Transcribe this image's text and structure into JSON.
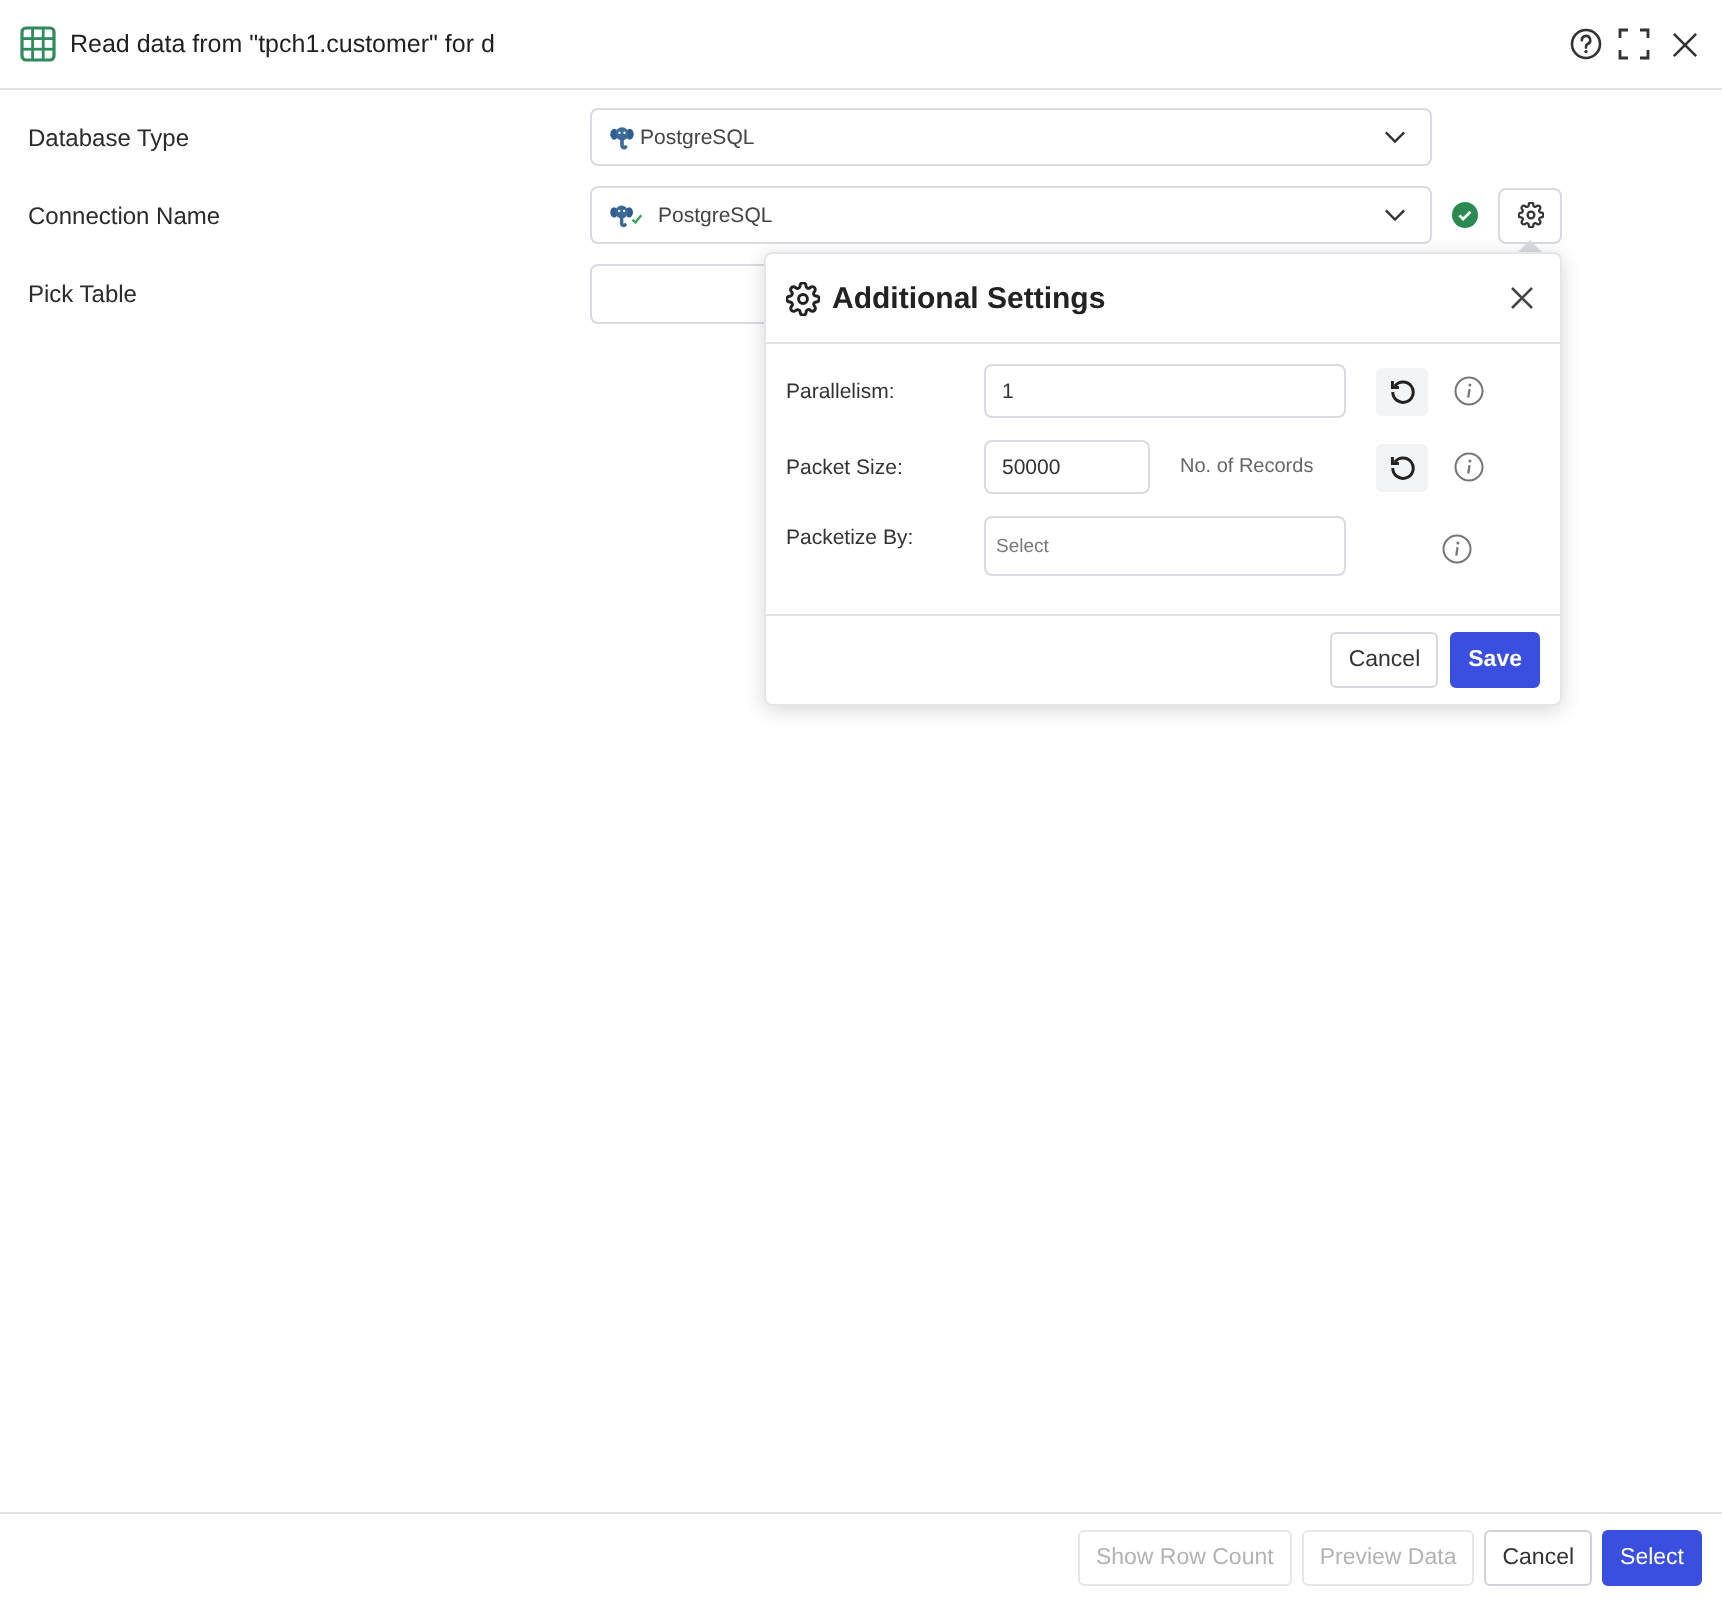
{
  "window": {
    "title": "Read data from \"tpch1.customer\" for d"
  },
  "form": {
    "fields": [
      {
        "label": "Database Type",
        "kind": "select",
        "value": "PostgreSQL"
      },
      {
        "label": "Connection Name",
        "kind": "connection",
        "value": "PostgreSQL",
        "verified": true
      },
      {
        "label": "Pick Table",
        "kind": "input"
      }
    ]
  },
  "popover": {
    "title": "Additional Settings",
    "rows": [
      {
        "label": "Parallelism:",
        "kind": "wide",
        "value": "1",
        "resettable": true
      },
      {
        "label": "Packet Size:",
        "kind": "narrow",
        "value": "50000",
        "unit": "No. of Records",
        "resettable": true
      },
      {
        "label": "Packetize By:",
        "kind": "tall",
        "placeholder": "Select",
        "resettable": false
      }
    ],
    "buttons": [
      {
        "label": "Cancel",
        "primary": false
      },
      {
        "label": "Save",
        "primary": true
      }
    ]
  },
  "footer": {
    "buttons": [
      {
        "label": "Show Row Count",
        "disabled": true,
        "primary": false
      },
      {
        "label": "Preview Data",
        "disabled": true,
        "primary": false
      },
      {
        "label": "Cancel",
        "disabled": false,
        "primary": false
      },
      {
        "label": "Select",
        "disabled": false,
        "primary": true
      }
    ]
  }
}
